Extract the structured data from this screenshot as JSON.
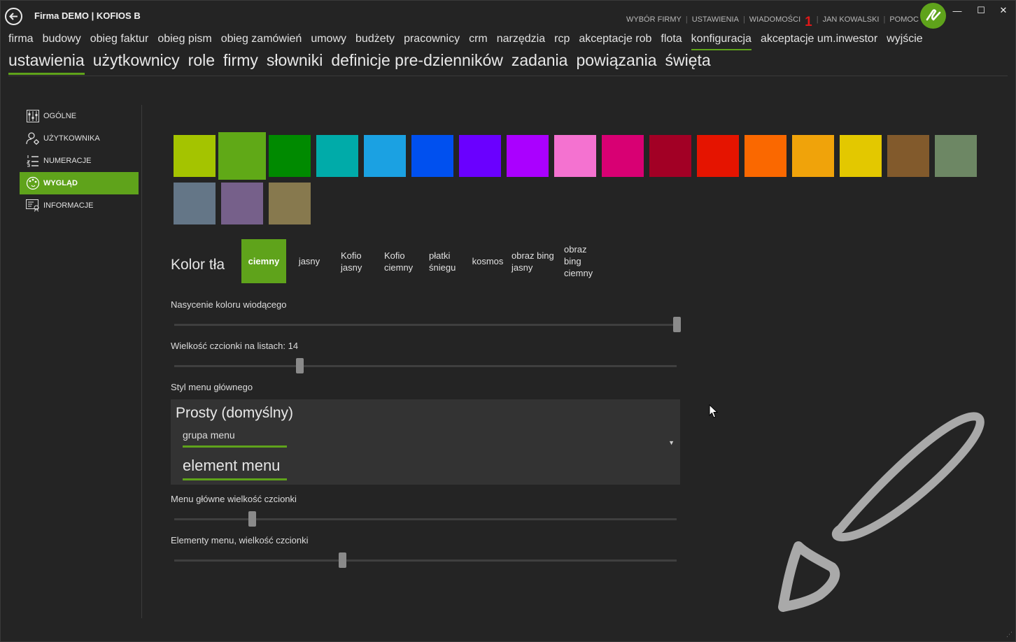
{
  "window": {
    "title": "Firma DEMO | KOFIOS B",
    "top_links": [
      "WYBÓR FIRMY",
      "USTAWIENIA",
      "WIADOMOŚCI",
      "JAN KOWALSKI",
      "POMOC"
    ],
    "messages_badge": "1",
    "controls": {
      "minimize": "—",
      "maximize": "☐",
      "close": "✕"
    }
  },
  "main_nav": [
    "firma",
    "budowy",
    "obieg faktur",
    "obieg pism",
    "obieg zamówień",
    "umowy",
    "budżety",
    "pracownicy",
    "crm",
    "narzędzia",
    "rcp",
    "akceptacje rob",
    "flota",
    "konfiguracja",
    "akceptacje um.inwestor",
    "wyjście"
  ],
  "main_nav_active": "konfiguracja",
  "sub_nav": [
    "ustawienia",
    "użytkownicy",
    "role",
    "firmy",
    "słowniki",
    "definicje pre-dzienników",
    "zadania",
    "powiązania",
    "święta"
  ],
  "sub_nav_active": "ustawienia",
  "sidebar": [
    {
      "label": "OGÓLNE",
      "icon": "settings-sliders-icon"
    },
    {
      "label": "UŻYTKOWNIKA",
      "icon": "user-gear-icon"
    },
    {
      "label": "NUMERACJE",
      "icon": "numbered-list-icon"
    },
    {
      "label": "WYGLĄD",
      "icon": "palette-icon",
      "active": true
    },
    {
      "label": "INFORMACJE",
      "icon": "info-document-icon"
    }
  ],
  "accent_colors": [
    "#a4c400",
    "#60a917",
    "#008a00",
    "#00aba9",
    "#1ba1e2",
    "#0050ef",
    "#6a00ff",
    "#aa00ff",
    "#f472d0",
    "#d80073",
    "#a20025",
    "#e51400",
    "#fa6800",
    "#f0a30a",
    "#e3c800",
    "#825a2c",
    "#6d8764",
    "#647687",
    "#76608a",
    "#87794e"
  ],
  "selected_accent": "#60a917",
  "background": {
    "label": "Kolor tła",
    "options": [
      "ciemny",
      "jasny",
      "Kofio jasny",
      "Kofio ciemny",
      "płatki śniegu",
      "kosmos",
      "obraz bing jasny",
      "obraz bing ciemny"
    ],
    "active": "ciemny"
  },
  "sliders": {
    "saturation": {
      "label": "Nasycenie koloru wiodącego",
      "value": 1.0
    },
    "list_font": {
      "label": "Wielkość czcionki na listach: 14",
      "value": 0.25
    },
    "menu_font": {
      "label": "Menu główne wielkość czcionki",
      "value": 0.155
    },
    "element_font": {
      "label": "Elementy menu, wielkość czcionki",
      "value": 0.335
    }
  },
  "menu_style": {
    "label": "Styl menu głównego",
    "selected": "Prosty (domyślny)",
    "group_sample": "grupa menu",
    "element_sample": "element menu"
  }
}
